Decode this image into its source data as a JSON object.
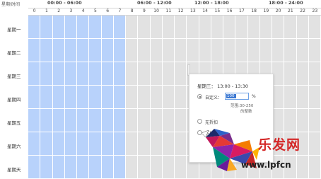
{
  "header": {
    "corner": "星期\\时间",
    "ranges": [
      "00:00 - 06:00",
      "06:00 - 12:00",
      "12:00 - 18:00",
      "18:00 - 24:00"
    ],
    "hours": [
      "0",
      "1",
      "2",
      "3",
      "4",
      "5",
      "6",
      "7",
      "8",
      "9",
      "10",
      "11",
      "12",
      "13",
      "14",
      "15",
      "16",
      "17",
      "18",
      "19",
      "20",
      "21",
      "22",
      "23"
    ]
  },
  "days": [
    "星期一",
    "星期二",
    "星期三",
    "星期四",
    "星期五",
    "星期六",
    "星期天"
  ],
  "schedule": {
    "selected_hours_per_day": 8,
    "colors": {
      "selected": "#b8d2fb",
      "unselected": "#e2e2e2"
    }
  },
  "popup": {
    "title": "星期三： 13:00 - 13:30",
    "options": [
      {
        "label": "自定义：",
        "checked": true
      },
      {
        "label": "无折扣",
        "checked": false
      },
      {
        "label": "不投放",
        "checked": false
      }
    ],
    "percent_value": "100",
    "percent_sign": "%",
    "range_hint": "范围:30-250",
    "range_hint_2": "的整数"
  },
  "watermark": {
    "text": "乐发网",
    "url": "www.lpfcn"
  }
}
